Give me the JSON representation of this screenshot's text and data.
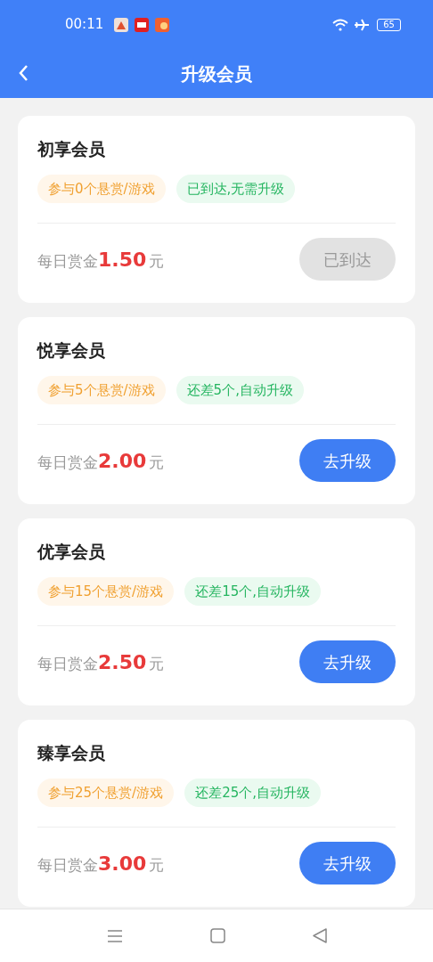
{
  "status_bar": {
    "time": "00:11",
    "battery": "65"
  },
  "header": {
    "title": "升级会员"
  },
  "cards": [
    {
      "title": "初享会员",
      "requirement": "参与0个悬赏/游戏",
      "progress": "已到达,无需升级",
      "reward_label": "每日赏金",
      "reward_amount": "1.50",
      "reward_unit": "元",
      "button": "已到达",
      "disabled": true
    },
    {
      "title": "悦享会员",
      "requirement": "参与5个悬赏/游戏",
      "progress": "还差5个,自动升级",
      "reward_label": "每日赏金",
      "reward_amount": "2.00",
      "reward_unit": "元",
      "button": "去升级",
      "disabled": false
    },
    {
      "title": "优享会员",
      "requirement": "参与15个悬赏/游戏",
      "progress": "还差15个,自动升级",
      "reward_label": "每日赏金",
      "reward_amount": "2.50",
      "reward_unit": "元",
      "button": "去升级",
      "disabled": false
    },
    {
      "title": "臻享会员",
      "requirement": "参与25个悬赏/游戏",
      "progress": "还差25个,自动升级",
      "reward_label": "每日赏金",
      "reward_amount": "3.00",
      "reward_unit": "元",
      "button": "去升级",
      "disabled": false
    }
  ]
}
